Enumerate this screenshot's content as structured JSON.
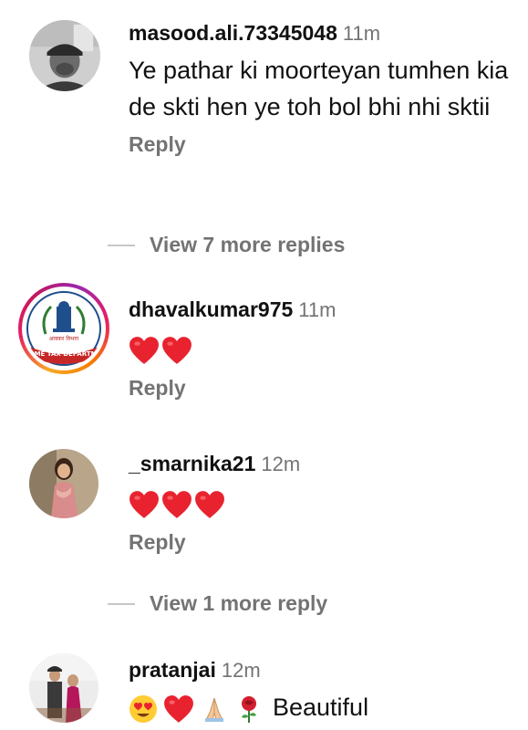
{
  "comments": [
    {
      "username": "masood.ali.73345048",
      "time": "11m",
      "text": "Ye pathar ki moorteyan tumhen kia de skti hen ye toh bol bhi nhi sktii",
      "reply_label": "Reply",
      "avatar_icon": "person-with-cap-avatar",
      "view_more": "View 7 more replies"
    },
    {
      "username": "dhavalkumar975",
      "time": "11m",
      "emoji": [
        "red-heart-icon",
        "red-heart-icon"
      ],
      "reply_label": "Reply",
      "avatar_icon": "income-tax-department-logo",
      "avatar_logo_text": "INCOME TAX DEPARTMENT",
      "has_story_ring": true
    },
    {
      "username": "_smarnika21",
      "time": "12m",
      "emoji": [
        "red-heart-icon",
        "red-heart-icon",
        "red-heart-icon"
      ],
      "reply_label": "Reply",
      "avatar_icon": "woman-in-saree-avatar",
      "view_more": "View 1 more reply"
    },
    {
      "username": "pratanjai",
      "time": "12m",
      "emoji": [
        "heart-eyes-emoji",
        "red-heart-icon",
        "folded-hands-emoji",
        "rose-emoji"
      ],
      "text": "Beautiful",
      "avatar_icon": "couple-photo-avatar"
    }
  ],
  "colors": {
    "muted_text": "#737373",
    "heart_red": "#e8232f",
    "divider": "#c7c7c7"
  }
}
